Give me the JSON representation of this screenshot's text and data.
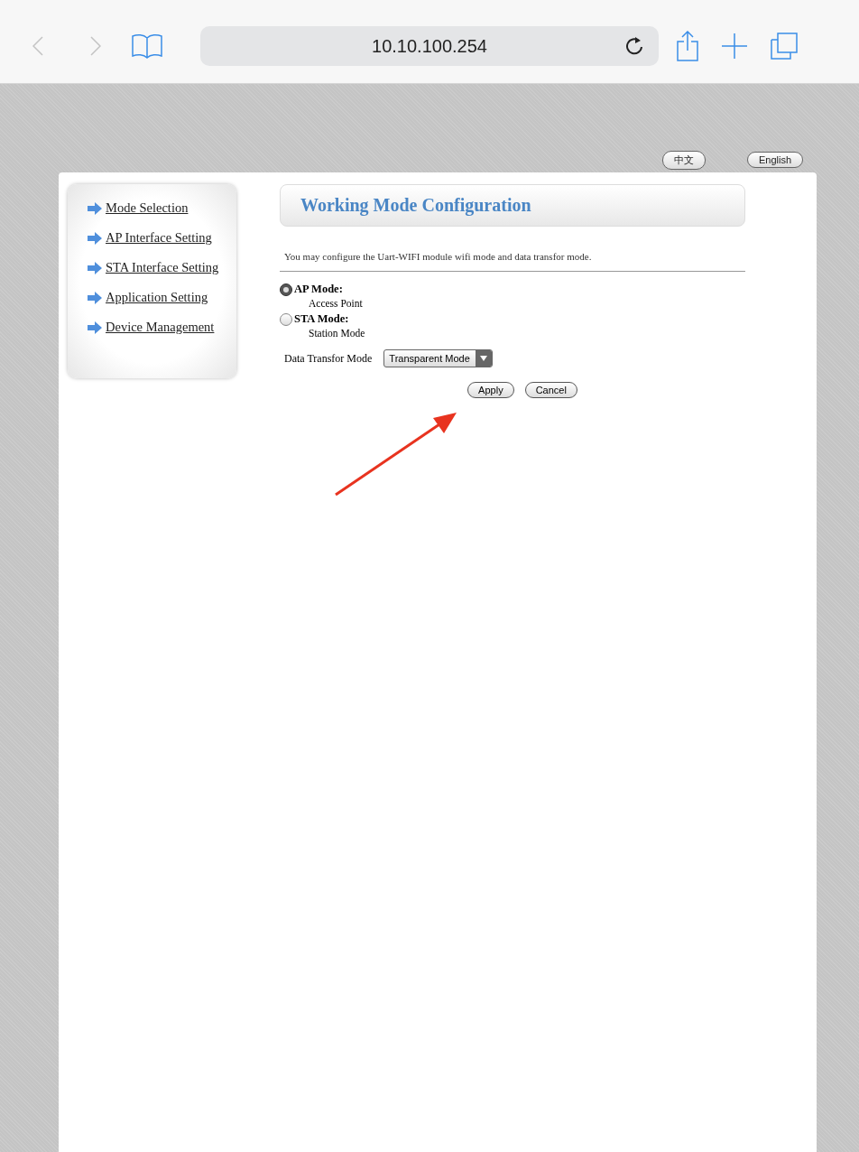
{
  "browser": {
    "address": "10.10.100.254"
  },
  "languages": [
    "中文",
    "English"
  ],
  "sidebar": {
    "items": [
      {
        "label": "Mode Selection"
      },
      {
        "label": "AP Interface Setting"
      },
      {
        "label": "STA Interface Setting"
      },
      {
        "label": "Application Setting"
      },
      {
        "label": "Device Management"
      }
    ]
  },
  "header": {
    "title": "Working Mode Configuration"
  },
  "description": "You may configure the Uart-WIFI module wifi mode and data transfor mode.",
  "modes": [
    {
      "label": "AP Mode:",
      "sublabel": "Access Point",
      "selected": true
    },
    {
      "label": "STA Mode:",
      "sublabel": "Station Mode",
      "selected": false
    }
  ],
  "transfer": {
    "label": "Data Transfor Mode",
    "value": "Transparent Mode"
  },
  "buttons": [
    "Apply",
    "Cancel"
  ]
}
